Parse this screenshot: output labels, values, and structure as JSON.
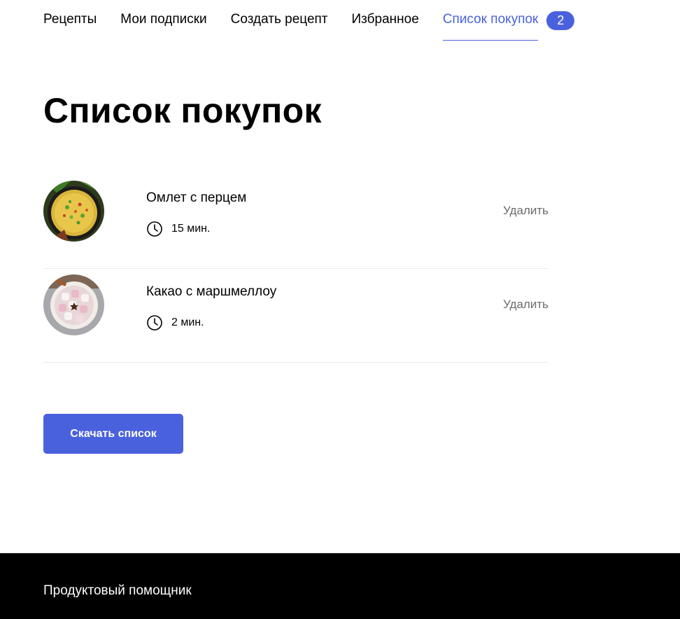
{
  "nav": {
    "items": [
      {
        "label": "Рецепты"
      },
      {
        "label": "Мои подписки"
      },
      {
        "label": "Создать рецепт"
      },
      {
        "label": "Избранное"
      }
    ],
    "active": {
      "label": "Список покупок",
      "badge": "2"
    }
  },
  "page": {
    "title": "Список покупок"
  },
  "list": {
    "items": [
      {
        "title": "Омлет с перцем",
        "time": "15 мин.",
        "delete_label": "Удалить",
        "image": "omelette-photo"
      },
      {
        "title": "Какао с маршмеллоу",
        "time": "2 мин.",
        "delete_label": "Удалить",
        "image": "cocoa-marshmallow-photo"
      }
    ]
  },
  "actions": {
    "download_label": "Скачать список"
  },
  "footer": {
    "brand": "Продуктовый помощник"
  },
  "colors": {
    "accent": "#4a61dd",
    "footer_bg": "#000000",
    "muted_text": "#6b6b6b",
    "divider": "#ececec"
  },
  "icons": {
    "time": "clock-icon"
  }
}
